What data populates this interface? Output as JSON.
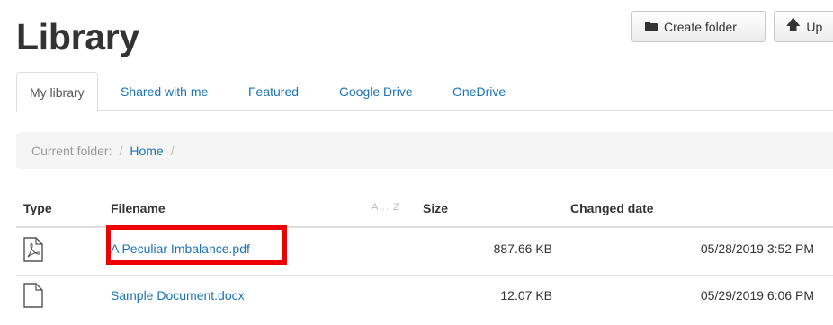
{
  "header": {
    "title": "Library",
    "create_folder_label": "Create folder",
    "upload_label": "Up"
  },
  "tabs": [
    {
      "label": "My library",
      "active": true
    },
    {
      "label": "Shared with me",
      "active": false
    },
    {
      "label": "Featured",
      "active": false
    },
    {
      "label": "Google Drive",
      "active": false
    },
    {
      "label": "OneDrive",
      "active": false
    }
  ],
  "breadcrumb": {
    "prefix": "Current folder:",
    "separator": "/",
    "home": "Home"
  },
  "table": {
    "columns": {
      "type": "Type",
      "filename": "Filename",
      "sort_hint": "A .. Z",
      "size": "Size",
      "changed_date": "Changed date"
    },
    "rows": [
      {
        "icon": "pdf-file-icon",
        "filename": "A Peculiar Imbalance.pdf",
        "size": "887.66 KB",
        "changed": "05/28/2019 3:52 PM",
        "highlighted": true
      },
      {
        "icon": "document-file-icon",
        "filename": "Sample Document.docx",
        "size": "12.07 KB",
        "changed": "05/29/2019 6:06 PM",
        "highlighted": false
      }
    ]
  },
  "colors": {
    "link": "#1a73b8",
    "highlight": "#ee0000",
    "breadcrumb_bg": "#f5f5f5"
  }
}
